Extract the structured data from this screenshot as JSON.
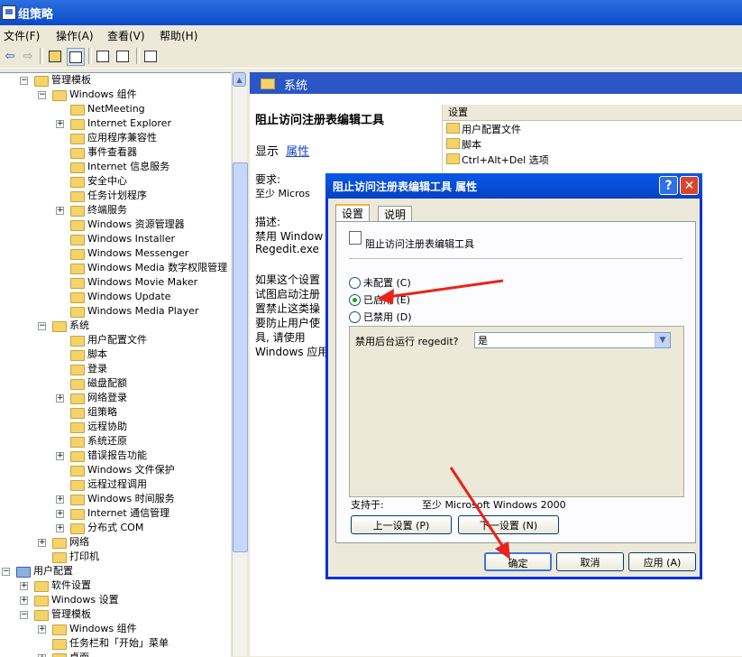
{
  "app": {
    "title": "组策略"
  },
  "menu": [
    "文件(F)",
    "操作(A)",
    "查看(V)",
    "帮助(H)"
  ],
  "tree": [
    {
      "depth": 1,
      "expander": "−",
      "label": "管理模板"
    },
    {
      "depth": 2,
      "expander": "−",
      "label": "Windows 组件"
    },
    {
      "depth": 3,
      "expander": "",
      "label": "NetMeeting"
    },
    {
      "depth": 3,
      "expander": "+",
      "label": "Internet Explorer"
    },
    {
      "depth": 3,
      "expander": "",
      "label": "应用程序兼容性"
    },
    {
      "depth": 3,
      "expander": "",
      "label": "事件查看器"
    },
    {
      "depth": 3,
      "expander": "",
      "label": "Internet 信息服务"
    },
    {
      "depth": 3,
      "expander": "",
      "label": "安全中心"
    },
    {
      "depth": 3,
      "expander": "",
      "label": "任务计划程序"
    },
    {
      "depth": 3,
      "expander": "+",
      "label": "终端服务"
    },
    {
      "depth": 3,
      "expander": "",
      "label": "Windows 资源管理器"
    },
    {
      "depth": 3,
      "expander": "",
      "label": "Windows Installer"
    },
    {
      "depth": 3,
      "expander": "",
      "label": "Windows Messenger"
    },
    {
      "depth": 3,
      "expander": "",
      "label": "Windows Media 数字权限管理"
    },
    {
      "depth": 3,
      "expander": "",
      "label": "Windows Movie Maker"
    },
    {
      "depth": 3,
      "expander": "",
      "label": "Windows Update"
    },
    {
      "depth": 3,
      "expander": "",
      "label": "Windows Media Player"
    },
    {
      "depth": 2,
      "expander": "−",
      "label": "系统"
    },
    {
      "depth": 3,
      "expander": "",
      "label": "用户配置文件"
    },
    {
      "depth": 3,
      "expander": "",
      "label": "脚本"
    },
    {
      "depth": 3,
      "expander": "",
      "label": "登录"
    },
    {
      "depth": 3,
      "expander": "",
      "label": "磁盘配额"
    },
    {
      "depth": 3,
      "expander": "+",
      "label": "网络登录"
    },
    {
      "depth": 3,
      "expander": "",
      "label": "组策略"
    },
    {
      "depth": 3,
      "expander": "",
      "label": "远程协助"
    },
    {
      "depth": 3,
      "expander": "",
      "label": "系统还原"
    },
    {
      "depth": 3,
      "expander": "+",
      "label": "错误报告功能"
    },
    {
      "depth": 3,
      "expander": "",
      "label": "Windows 文件保护"
    },
    {
      "depth": 3,
      "expander": "",
      "label": "远程过程调用"
    },
    {
      "depth": 3,
      "expander": "+",
      "label": "Windows 时间服务"
    },
    {
      "depth": 3,
      "expander": "+",
      "label": "Internet 通信管理"
    },
    {
      "depth": 3,
      "expander": "+",
      "label": "分布式 COM"
    },
    {
      "depth": 2,
      "expander": "+",
      "label": "网络"
    },
    {
      "depth": 2,
      "expander": "",
      "label": "打印机"
    },
    {
      "depth": 0,
      "expander": "−",
      "label": "用户配置",
      "user": true
    },
    {
      "depth": 1,
      "expander": "+",
      "label": "软件设置"
    },
    {
      "depth": 1,
      "expander": "+",
      "label": "Windows 设置"
    },
    {
      "depth": 1,
      "expander": "−",
      "label": "管理模板"
    },
    {
      "depth": 2,
      "expander": "+",
      "label": "Windows 组件"
    },
    {
      "depth": 2,
      "expander": "",
      "label": "任务栏和「开始」菜单"
    },
    {
      "depth": 2,
      "expander": "+",
      "label": "桌面"
    }
  ],
  "right": {
    "header": "系统",
    "policy_title": "阻止访问注册表编辑工具",
    "show_label": "显示",
    "show_link": "属性",
    "req_label": "要求:",
    "req_text": "至少 Micros",
    "desc_label": "描述:",
    "desc_lines": [
      "禁用 Window",
      "Regedit.exe",
      "",
      "如果这个设置",
      "试图启动注册",
      "置禁止这类操",
      "要防止用户使",
      "具, 请使用",
      "Windows 应用"
    ],
    "settings_header": "设置",
    "settings_items": [
      "用户配置文件",
      "脚本",
      "Ctrl+Alt+Del 选项"
    ]
  },
  "dialog": {
    "title": "阻止访问注册表编辑工具 属性",
    "help": "?",
    "close": "✕",
    "tabs": [
      "设置",
      "说明"
    ],
    "policy_name": "阻止访问注册表编辑工具",
    "radio_not_configured": "未配置 (C)",
    "radio_enabled": "已启用 (E)",
    "radio_disabled": "已禁用 (D)",
    "option_label": "禁用后台运行 regedit?",
    "option_value": "是",
    "supported_label": "支持于:",
    "supported_value": "至少 Microsoft Windows 2000",
    "prev_button": "上一设置 (P)",
    "next_button": "下一设置 (N)",
    "ok": "确定",
    "cancel": "取消",
    "apply": "应用 (A)"
  },
  "colors": {
    "accent_arrow": "#e8231a",
    "xp_blue": "#0a58e6"
  }
}
